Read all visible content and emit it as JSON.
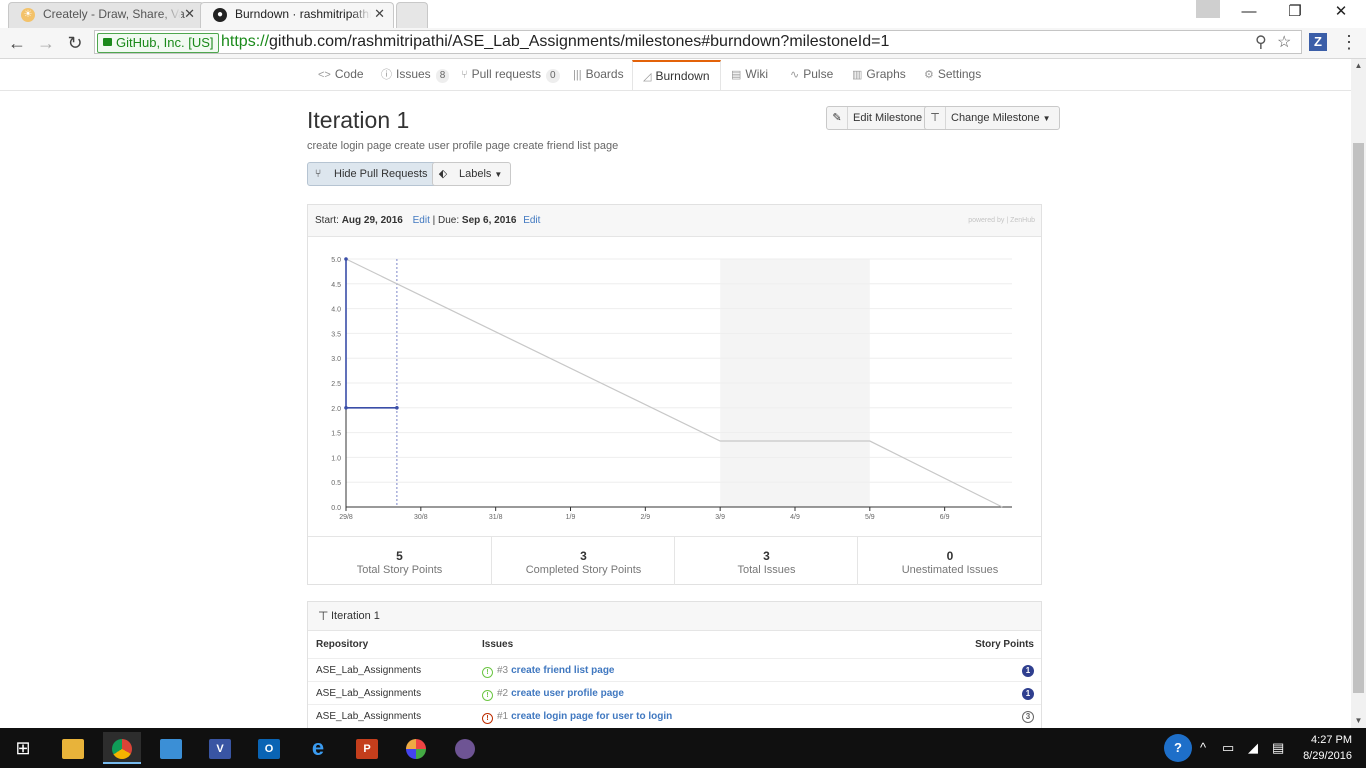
{
  "browser": {
    "tabs": [
      {
        "title": "Creately - Draw, Share, Va",
        "active": false
      },
      {
        "title": "Burndown · rashmitripathi",
        "active": true
      }
    ],
    "ev_label": "GitHub, Inc. [US]",
    "url_scheme": "https://",
    "url_rest": "github.com/rashmitripathi/ASE_Lab_Assignments/milestones#burndown?milestoneId=1",
    "extension_label": "Z"
  },
  "reponav": {
    "code": "Code",
    "issues": "Issues",
    "issues_count": "8",
    "pulls": "Pull requests",
    "pulls_count": "0",
    "boards": "Boards",
    "burndown": "Burndown",
    "wiki": "Wiki",
    "pulse": "Pulse",
    "graphs": "Graphs",
    "settings": "Settings"
  },
  "milestone": {
    "title": "Iteration 1",
    "description": "create login page create user profile page create friend list page",
    "edit_button": "Edit Milestone",
    "change_button": "Change Milestone",
    "hide_pr_button": "Hide Pull Requests",
    "labels_button": "Labels"
  },
  "burndown": {
    "start_label": "Start:",
    "start_date": "Aug 29, 2016",
    "edit1": "Edit",
    "due_label": "| Due:",
    "due_date": "Sep 6, 2016",
    "edit2": "Edit",
    "powered_by": "powered by | ZenHub"
  },
  "chart_data": {
    "type": "line",
    "y_ticks": [
      "0.0",
      "0.5",
      "1.0",
      "1.5",
      "2.0",
      "2.5",
      "3.0",
      "3.5",
      "4.0",
      "4.5",
      "5.0"
    ],
    "ylim": [
      0,
      5
    ],
    "x_ticks": [
      "29/8",
      "30/8",
      "31/8",
      "1/9",
      "2/9",
      "3/9",
      "4/9",
      "5/9",
      "6/9"
    ],
    "x_range_days": [
      0,
      8.9
    ],
    "weekend_shade": [
      5,
      7
    ],
    "today_marker": 0.68,
    "series": [
      {
        "type": "ideal",
        "color": "#c8c8c8",
        "points": [
          [
            0,
            5
          ],
          [
            5,
            1.33
          ],
          [
            7,
            1.33
          ],
          [
            8.77,
            0
          ]
        ]
      },
      {
        "type": "actual",
        "color": "#3a4ea8",
        "points": [
          [
            0,
            5
          ],
          [
            0,
            2
          ],
          [
            0.68,
            2
          ]
        ]
      }
    ]
  },
  "stats": [
    {
      "value": "5",
      "label": "Total Story Points"
    },
    {
      "value": "3",
      "label": "Completed Story Points"
    },
    {
      "value": "3",
      "label": "Total Issues"
    },
    {
      "value": "0",
      "label": "Unestimated Issues"
    }
  ],
  "issues_table": {
    "heading": "Iteration 1",
    "col_repo": "Repository",
    "col_issues": "Issues",
    "col_points": "Story Points",
    "rows": [
      {
        "repo": "ASE_Lab_Assignments",
        "number": "#3",
        "title": "create friend list page",
        "points": "1",
        "state": "open"
      },
      {
        "repo": "ASE_Lab_Assignments",
        "number": "#2",
        "title": "create user profile page",
        "points": "1",
        "state": "open"
      },
      {
        "repo": "ASE_Lab_Assignments",
        "number": "#1",
        "title": "create login page for user to login",
        "points": "3",
        "state": "closed"
      }
    ]
  },
  "taskbar": {
    "time": "4:27 PM",
    "date": "8/29/2016"
  }
}
